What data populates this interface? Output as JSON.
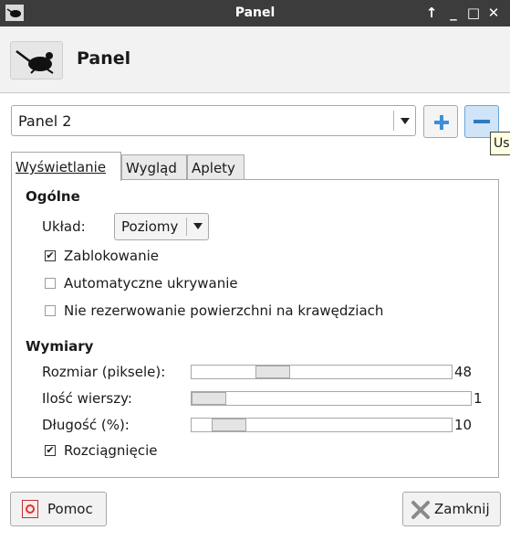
{
  "window": {
    "title": "Panel",
    "controls": {
      "up": "↑",
      "minimize": "_",
      "maximize": "□",
      "close": "✕"
    }
  },
  "header": {
    "title": "Panel",
    "icon": "mouse-icon"
  },
  "panel_select": {
    "value": "Panel 2"
  },
  "add_button": {
    "icon": "plus-icon"
  },
  "remove_button": {
    "icon": "minus-icon"
  },
  "tooltip": {
    "text": "Us"
  },
  "tabs": [
    {
      "label": "Wyświetlanie",
      "active": true
    },
    {
      "label": "Wygląd",
      "active": false
    },
    {
      "label": "Aplety",
      "active": false
    }
  ],
  "general": {
    "heading": "Ogólne",
    "layout_label": "Układ:",
    "layout_value": "Poziomy",
    "lock_label": "Zablokowanie",
    "lock_checked": true,
    "autohide_label": "Automatyczne ukrywanie",
    "autohide_checked": false,
    "reserve_label": "Nie rezerwowanie powierzchni na krawędziach",
    "reserve_checked": false
  },
  "dimensions": {
    "heading": "Wymiary",
    "size_label": "Rozmiar (piksele):",
    "size_value": "48",
    "rows_label": "Ilość wierszy:",
    "rows_value": "1",
    "length_label": "Długość (%):",
    "length_value": "10",
    "stretch_label": "Rozciągnięcie",
    "stretch_checked": true
  },
  "footer": {
    "help_label": "Pomoc",
    "close_label": "Zamknij"
  },
  "colors": {
    "titlebar": "#3c3c3c",
    "accent": "#3d8fd8"
  }
}
